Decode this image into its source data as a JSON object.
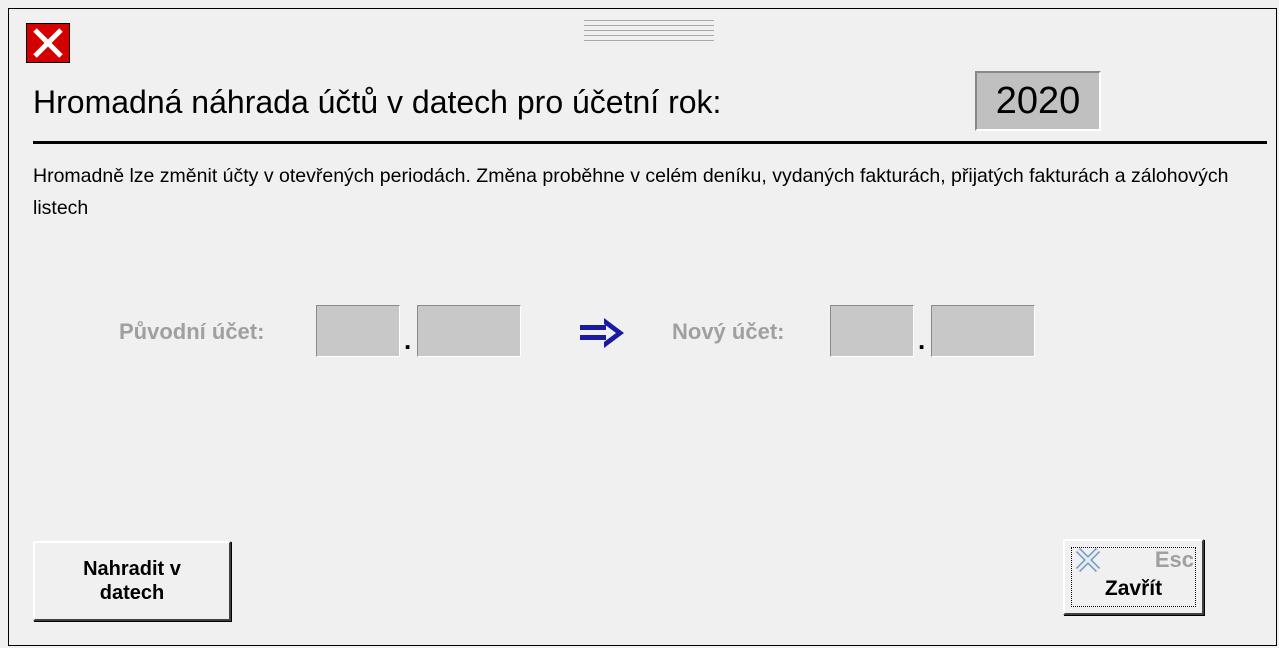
{
  "dialog": {
    "title": "Hromadná náhrada účtů v datech pro účetní rok:",
    "year": "2020",
    "description": "Hromadně lze změnit účty v otevřených periodách. Změna proběhne v celém deníku, vydaných fakturách, přijatých fakturách a zálohových listech"
  },
  "form": {
    "original_label": "Původní účet:",
    "new_label": "Nový účet:",
    "separator": ".",
    "original_account_part1": "",
    "original_account_part2": "",
    "new_account_part1": "",
    "new_account_part2": ""
  },
  "buttons": {
    "replace_label": "Nahradit v datech",
    "close_shortcut": "Esc",
    "close_label": "Zavřít"
  },
  "icons": {
    "close": "close-icon",
    "arrow": "double-arrow-right-icon",
    "drag": "drag-grip-icon"
  },
  "colors": {
    "close_red": "#d40000",
    "arrow_blue": "#1a1aa0",
    "disabled_text": "#a0a0a0"
  }
}
